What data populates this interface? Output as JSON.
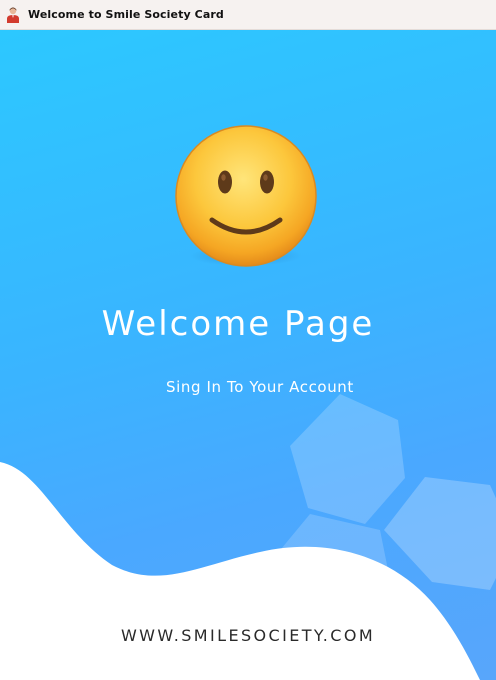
{
  "window": {
    "title": "Welcome to Smile Society Card",
    "icon": "user-person-icon"
  },
  "main": {
    "emoji": "slightly-smiling-face-emoji",
    "heading": "Welcome Page",
    "subtitle": "Sing In To Your Account",
    "website": "WWW.SMILESOCIETY.COM"
  },
  "colors": {
    "gradient_top": "#2cc8ff",
    "gradient_bottom": "#58a6fb",
    "titlebar_bg": "#f6f2f0",
    "text_light": "#ffffff",
    "text_dark": "#2a2a2a"
  }
}
